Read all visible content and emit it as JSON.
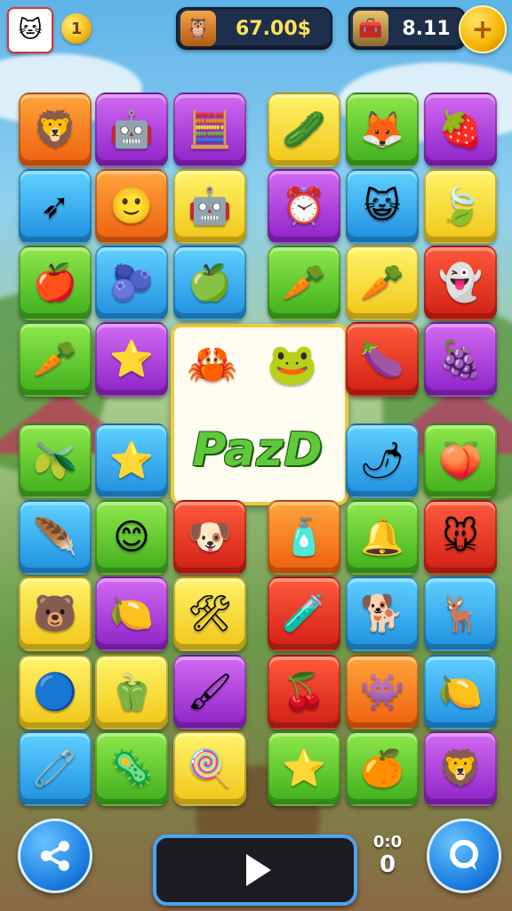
{
  "hud": {
    "avatar_icon": "cat-avatar-icon",
    "level_number": "1",
    "score_value": "67.00$",
    "score_icon": "owl-icon",
    "coins_value": "8.11",
    "coins_icon": "treasure-chest-icon",
    "add_icon": "plus-icon"
  },
  "board": {
    "rows": [
      [
        {
          "color": "orange",
          "icon": "lion-face-icon",
          "glyph": "🦁"
        },
        {
          "color": "purple",
          "icon": "robot-face-icon",
          "glyph": "🤖"
        },
        {
          "color": "purple",
          "icon": "calculator-icon",
          "glyph": "🧮"
        },
        {
          "color": "yellow",
          "icon": "cucumber-icon",
          "glyph": "🥒"
        },
        {
          "color": "green",
          "icon": "fox-face-icon",
          "glyph": "🦊"
        },
        {
          "color": "purple",
          "icon": "strawberry-icon",
          "glyph": "🍓"
        }
      ],
      [
        {
          "color": "blue",
          "icon": "arrow-icon",
          "glyph": "➶"
        },
        {
          "color": "orange",
          "icon": "smiley-face-icon",
          "glyph": "🙂"
        },
        {
          "color": "yellow",
          "icon": "robot-head-icon",
          "glyph": "🤖"
        },
        {
          "color": "purple",
          "icon": "clock-icon",
          "glyph": "⏰"
        },
        {
          "color": "blue",
          "icon": "cat-face-icon",
          "glyph": "😺"
        },
        {
          "color": "yellow",
          "icon": "leaf-icon",
          "glyph": "🍃"
        }
      ],
      [
        {
          "color": "green",
          "icon": "apple-icon",
          "glyph": "🍎"
        },
        {
          "color": "blue",
          "icon": "radish-icon",
          "glyph": "🫐"
        },
        {
          "color": "blue",
          "icon": "green-apple-icon",
          "glyph": "🍏"
        },
        {
          "color": "green",
          "icon": "carrot-icon",
          "glyph": "🥕"
        },
        {
          "color": "yellow",
          "icon": "carrot-icon",
          "glyph": "🥕"
        },
        {
          "color": "red",
          "icon": "ghost-face-icon",
          "glyph": "👻"
        }
      ],
      [
        {
          "color": "green",
          "icon": "carrot-icon",
          "glyph": "🥕"
        },
        {
          "color": "purple",
          "icon": "star-icon",
          "glyph": "⭐"
        },
        null,
        null,
        {
          "color": "red",
          "icon": "eggplant-icon",
          "glyph": "🍆"
        },
        {
          "color": "purple",
          "icon": "grape-bunch-icon",
          "glyph": "🍇"
        }
      ],
      [
        {
          "color": "green",
          "icon": "olive-icon",
          "glyph": "🫒"
        },
        {
          "color": "blue",
          "icon": "star-face-icon",
          "glyph": "⭐"
        },
        null,
        null,
        {
          "color": "blue",
          "icon": "chili-pepper-icon",
          "glyph": "🌶"
        },
        {
          "color": "green",
          "icon": "peach-icon",
          "glyph": "🍑"
        }
      ],
      [
        {
          "color": "blue",
          "icon": "feather-icon",
          "glyph": "🪶"
        },
        {
          "color": "green",
          "icon": "green-blob-icon",
          "glyph": "😊"
        },
        {
          "color": "red",
          "icon": "puppy-face-icon",
          "glyph": "🐶"
        },
        {
          "color": "orange",
          "icon": "bottle-icon",
          "glyph": "🧴"
        },
        {
          "color": "green",
          "icon": "cone-icon",
          "glyph": "🔔"
        },
        {
          "color": "red",
          "icon": "mouse-icon",
          "glyph": "🐭"
        }
      ],
      [
        {
          "color": "yellow",
          "icon": "bear-face-icon",
          "glyph": "🐻"
        },
        {
          "color": "purple",
          "icon": "lemon-face-icon",
          "glyph": "🍋"
        },
        {
          "color": "yellow",
          "icon": "tools-icon",
          "glyph": "🛠"
        },
        {
          "color": "red",
          "icon": "potion-bottle-icon",
          "glyph": "🧪"
        },
        {
          "color": "blue",
          "icon": "dog-icon",
          "glyph": "🐕"
        },
        {
          "color": "blue",
          "icon": "deer-icon",
          "glyph": "🦌"
        }
      ],
      [
        {
          "color": "yellow",
          "icon": "blue-ball-face-icon",
          "glyph": "🔵"
        },
        {
          "color": "yellow",
          "icon": "green-pepper-icon",
          "glyph": "🫑"
        },
        {
          "color": "purple",
          "icon": "paintbrush-icon",
          "glyph": "🖌"
        },
        {
          "color": "red",
          "icon": "cherry-icon",
          "glyph": "🍒"
        },
        {
          "color": "orange",
          "icon": "purple-monster-icon",
          "glyph": "👾"
        },
        {
          "color": "blue",
          "icon": "lemon-face-icon",
          "glyph": "🍋"
        }
      ],
      [
        {
          "color": "blue",
          "icon": "safety-pin-icon",
          "glyph": "🧷"
        },
        {
          "color": "green",
          "icon": "spiky-ball-icon",
          "glyph": "🦠"
        },
        {
          "color": "yellow",
          "icon": "lollipop-icon",
          "glyph": "🍭"
        },
        {
          "color": "green",
          "icon": "star-face-icon",
          "glyph": "⭐"
        },
        {
          "color": "green",
          "icon": "orange-face-icon",
          "glyph": "🍊"
        },
        {
          "color": "purple",
          "icon": "lion-cub-icon",
          "glyph": "🦁"
        }
      ]
    ],
    "center_panel": {
      "logo_text": "PazD",
      "icons": [
        {
          "icon": "red-creature-icon",
          "glyph": "🦀"
        },
        {
          "icon": "green-creature-icon",
          "glyph": "🐸"
        }
      ]
    }
  },
  "bottom": {
    "share_icon": "share-icon",
    "play_icon": "play-icon",
    "counter_top": "0:0",
    "counter_bottom": "0",
    "chat_icon": "chat-icon"
  }
}
